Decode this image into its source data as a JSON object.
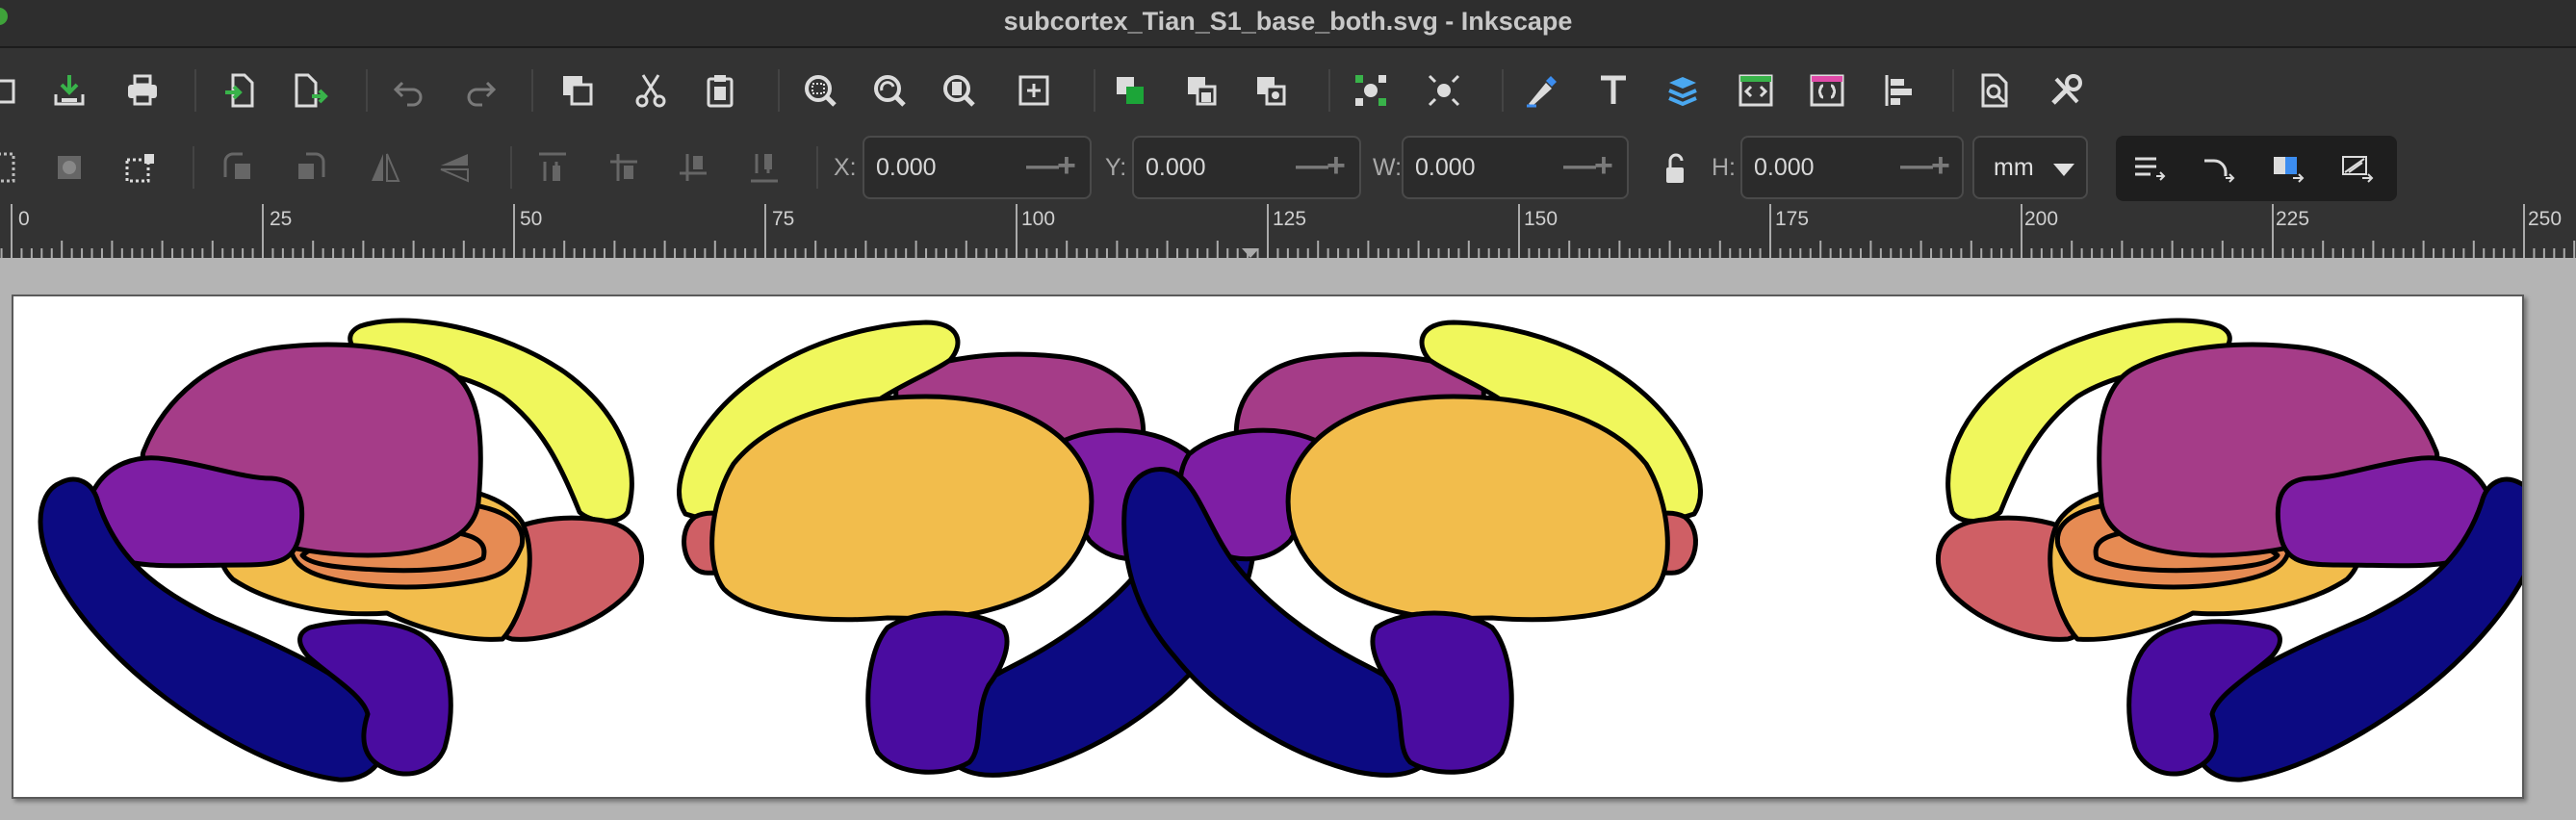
{
  "window": {
    "title": "subcortex_Tian_S1_base_both.svg - Inkscape"
  },
  "commands_bar": {
    "icons": [
      "open-icon",
      "save-icon",
      "print-icon",
      "import-icon",
      "export-icon",
      "undo-icon",
      "redo-icon",
      "duplicate-icon",
      "cut-icon",
      "paste-icon",
      "zoom-selection-icon",
      "zoom-drawing-icon",
      "zoom-page-icon",
      "zoom-fit-icon",
      "group-icon",
      "ungroup-icon",
      "unlink-clone-icon",
      "node-editor-icon",
      "transform-icon",
      "fill-stroke-icon",
      "text-icon",
      "layers-icon",
      "xml-editor-icon",
      "selectors-icon",
      "align-icon",
      "document-properties-icon",
      "preferences-icon"
    ]
  },
  "tool_controls": {
    "x": {
      "label": "X:",
      "value": "0.000"
    },
    "y": {
      "label": "Y:",
      "value": "0.000"
    },
    "w": {
      "label": "W:",
      "value": "0.000"
    },
    "h": {
      "label": "H:",
      "value": "0.000"
    },
    "minus": "—",
    "plus": "+",
    "unit": "mm",
    "lock_icon": "lock-open-icon"
  },
  "ruler": {
    "labels": [
      "0",
      "25",
      "50",
      "75",
      "100",
      "125",
      "150",
      "175",
      "200",
      "225",
      "250"
    ]
  },
  "colors": {
    "bg": "#333333",
    "canvas": "#b4b4b4",
    "navy": "#0c0a82",
    "indigo": "#4a0ca0",
    "purple": "#7e1ea4",
    "magenta": "#a53c88",
    "coral": "#cf5f65",
    "orange": "#e68b53",
    "gold": "#f2bd4c",
    "yellow": "#f0f75c"
  }
}
